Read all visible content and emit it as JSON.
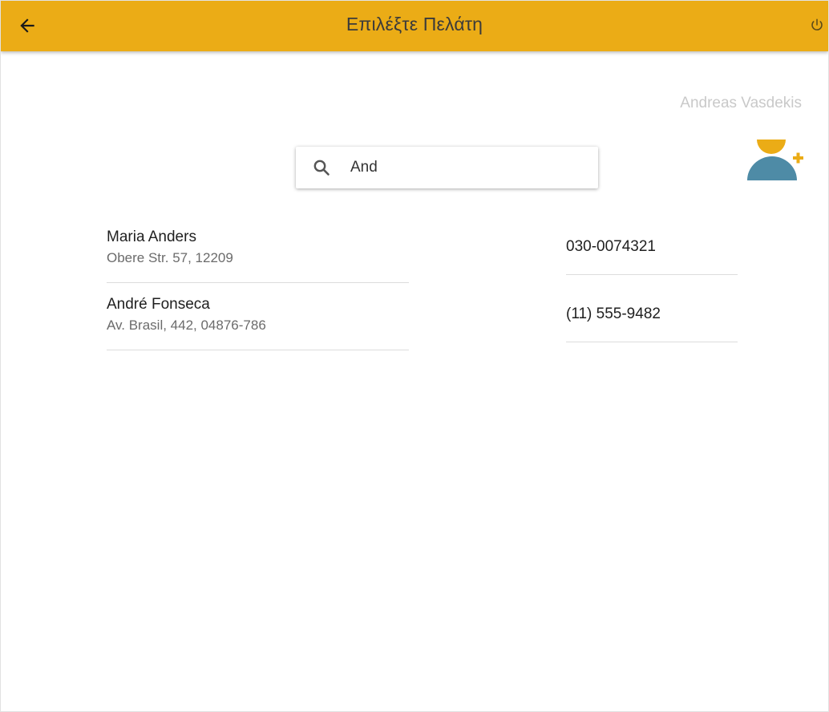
{
  "header": {
    "title": "Επιλέξτε Πελάτη",
    "back_icon": "arrow-left-icon",
    "power_icon": "power-icon",
    "background_color": "#ebac16"
  },
  "user": {
    "name": "Andreas Vasdekis"
  },
  "add_customer": {
    "icon": "add-person-icon",
    "head_color": "#ebac16",
    "body_color": "#4e8ba6",
    "plus_color": "#ebac16"
  },
  "search": {
    "icon": "search-icon",
    "value": "And"
  },
  "customers": [
    {
      "name": "Maria Anders",
      "address": "Obere Str. 57, 12209",
      "phone": "030-0074321"
    },
    {
      "name": "André Fonseca",
      "address": "Av. Brasil, 442, 04876-786",
      "phone": "(11) 555-9482"
    }
  ]
}
